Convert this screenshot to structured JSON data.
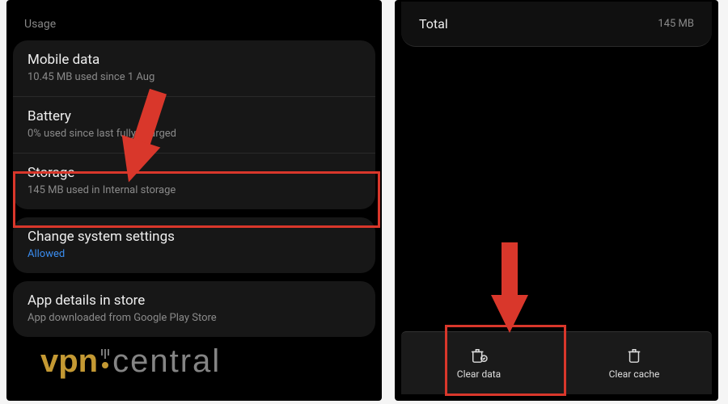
{
  "left": {
    "section_label": "Usage",
    "mobile_data": {
      "title": "Mobile data",
      "sub": "10.45 MB used since 1 Aug"
    },
    "battery": {
      "title": "Battery",
      "sub": "0% used since last fully charged"
    },
    "storage": {
      "title": "Storage",
      "sub": "145 MB used in Internal storage"
    },
    "change_settings": {
      "title": "Change system settings",
      "sub": "Allowed"
    },
    "app_details": {
      "title": "App details in store",
      "sub": "App downloaded from Google Play Store"
    }
  },
  "right": {
    "total": {
      "label": "Total",
      "value": "145 MB"
    },
    "actions": {
      "clear_data": "Clear data",
      "clear_cache": "Clear cache"
    }
  },
  "watermark": {
    "brand1": "vpn",
    "brand2": "central"
  },
  "icons": {
    "clear_data": "trash-data-icon",
    "clear_cache": "trash-cache-icon"
  },
  "annotations": {
    "highlight_color": "#d9372b"
  }
}
